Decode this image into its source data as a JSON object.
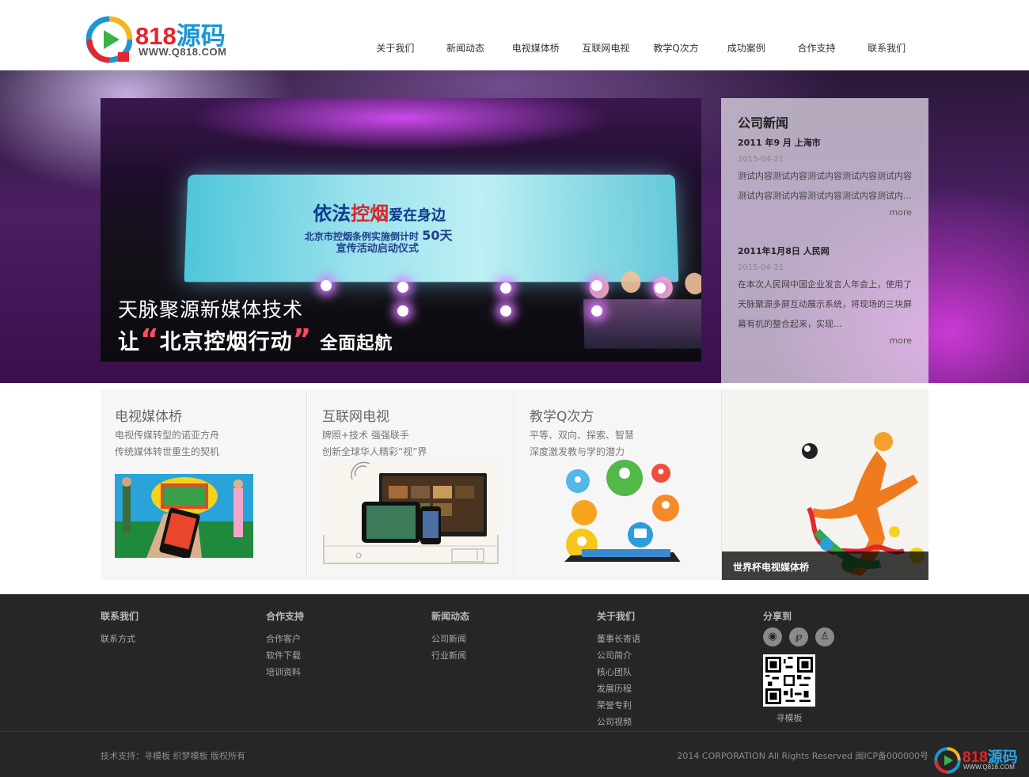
{
  "header": {
    "logo": {
      "number": "818",
      "name": "源码",
      "url_text": "WWW.Q818.COM"
    },
    "nav": [
      "关于我们",
      "新闻动态",
      "电视媒体桥",
      "互联网电视",
      "教学Q次方",
      "成功案例",
      "合作支持",
      "联系我们"
    ]
  },
  "hero": {
    "screen": {
      "line1_a": "依法",
      "line1_b": "控烟",
      "line1_c": "爱在身边",
      "line2": "北京市控烟条例实施倒计时",
      "line2_num": "50天",
      "line3": "宣传活动启动仪式"
    },
    "caption1": "天脉聚源新媒体技术",
    "caption2_a": "让",
    "caption2_q_open": "“",
    "caption2_b": "北京控烟行动",
    "caption2_q_close": "”",
    "caption2_c": "全面起航"
  },
  "news": {
    "title": "公司新闻",
    "items": [
      {
        "title": "2011 年9 月 上海市",
        "date": "2015-04-21",
        "text": "测试内容测试内容测试内容测试内容测试内容测试内容测试内容测试内容测试内容测试内...",
        "more": "more"
      },
      {
        "title": "2011年1月8日 人民网",
        "date": "2015-04-21",
        "text": "在本次人民网中国企业发言人年会上，使用了天脉聚源多屏互动展示系统，将现场的三块屏幕有机的整合起来，实现...",
        "more": "more"
      }
    ]
  },
  "features": [
    {
      "title": "电视媒体桥",
      "line1": "电视传媒转型的诺亚方舟",
      "line2": "传统媒体转世重生的契机"
    },
    {
      "title": "互联网电视",
      "line1": "牌照+技术 强强联手",
      "line2": "创新全球华人精彩“视”界"
    },
    {
      "title": "教学Q次方",
      "line1": "平等、双向、探索、智慧",
      "line2": "深度激发教与学的潜力"
    }
  ],
  "worldcup": {
    "caption": "世界杯电视媒体桥"
  },
  "footer": {
    "columns": [
      {
        "title": "联系我们",
        "links": [
          "联系方式"
        ]
      },
      {
        "title": "合作支持",
        "links": [
          "合作客户",
          "软件下载",
          "培训资料"
        ]
      },
      {
        "title": "新闻动态",
        "links": [
          "公司新闻",
          "行业新闻"
        ]
      },
      {
        "title": "关于我们",
        "links": [
          "董事长寄语",
          "公司简介",
          "核心团队",
          "发展历程",
          "荣誉专利",
          "公司视频"
        ]
      }
    ],
    "share": {
      "title": "分享到",
      "icons": [
        "weibo-icon",
        "tencent-weibo-icon",
        "qq-icon"
      ],
      "qr_label": "寻模板"
    },
    "copy_left": "技术支持：寻模板   织梦模板 版权所有",
    "copy_right": "2014 CORPORATION All Rights Reserved 闽ICP备000000号",
    "watermark": {
      "number": "818",
      "name": "源码",
      "url_text": "WWW.Q818.COM"
    }
  },
  "colors": {
    "logo_red": "#e7252c",
    "logo_blue": "#1a96d4",
    "footer_bg": "#262626"
  }
}
